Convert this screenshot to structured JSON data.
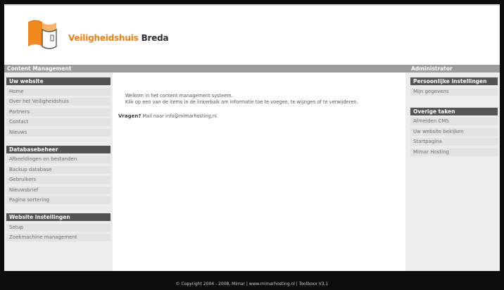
{
  "header": {
    "brand_part1": "Veiligheidshuis",
    "brand_part2": "Breda"
  },
  "strip": {
    "left_label": "Content Management",
    "right_label": "Administrator"
  },
  "left_sidebar": {
    "sections": [
      {
        "title": "Uw website",
        "items": [
          "Home",
          "Over het Veiligheidshuis",
          "Partners",
          "Contact",
          "Nieuws"
        ]
      },
      {
        "title": "Databasebeheer",
        "items": [
          "Afbeeldingen en bestanden",
          "Backup database",
          "Gebruikers",
          "Nieuwsbrief",
          "Pagina sortering"
        ]
      },
      {
        "title": "Website instellingen",
        "items": [
          "Setup",
          "Zoekmachine management"
        ]
      }
    ]
  },
  "right_sidebar": {
    "sections": [
      {
        "title": "Persoonlijke instellingen",
        "items": [
          "Mijn gegevens"
        ]
      },
      {
        "title": "Overige taken",
        "items": [
          "Afmelden CMS",
          "Uw website bekijken",
          "Startpagina",
          "Mimar Hosting"
        ]
      }
    ]
  },
  "main": {
    "welcome_line1": "Welkom in het content management systeem.",
    "welcome_line2": "Klik op een van de items in de linkerbalk om informatie toe te voegen, te wijzigen of te verwijderen.",
    "question_label": "Vragen?",
    "question_text": " Mail naar info@mimarhosting.nl."
  },
  "footer": {
    "text": "© Copyright 2004 - 2008, Mimar | www.mimarhosting.nl | Toolboxx V3.1"
  },
  "colors": {
    "brand_orange": "#e8821e",
    "section_header": "#545454",
    "strip_gray": "#9c9c9c"
  }
}
